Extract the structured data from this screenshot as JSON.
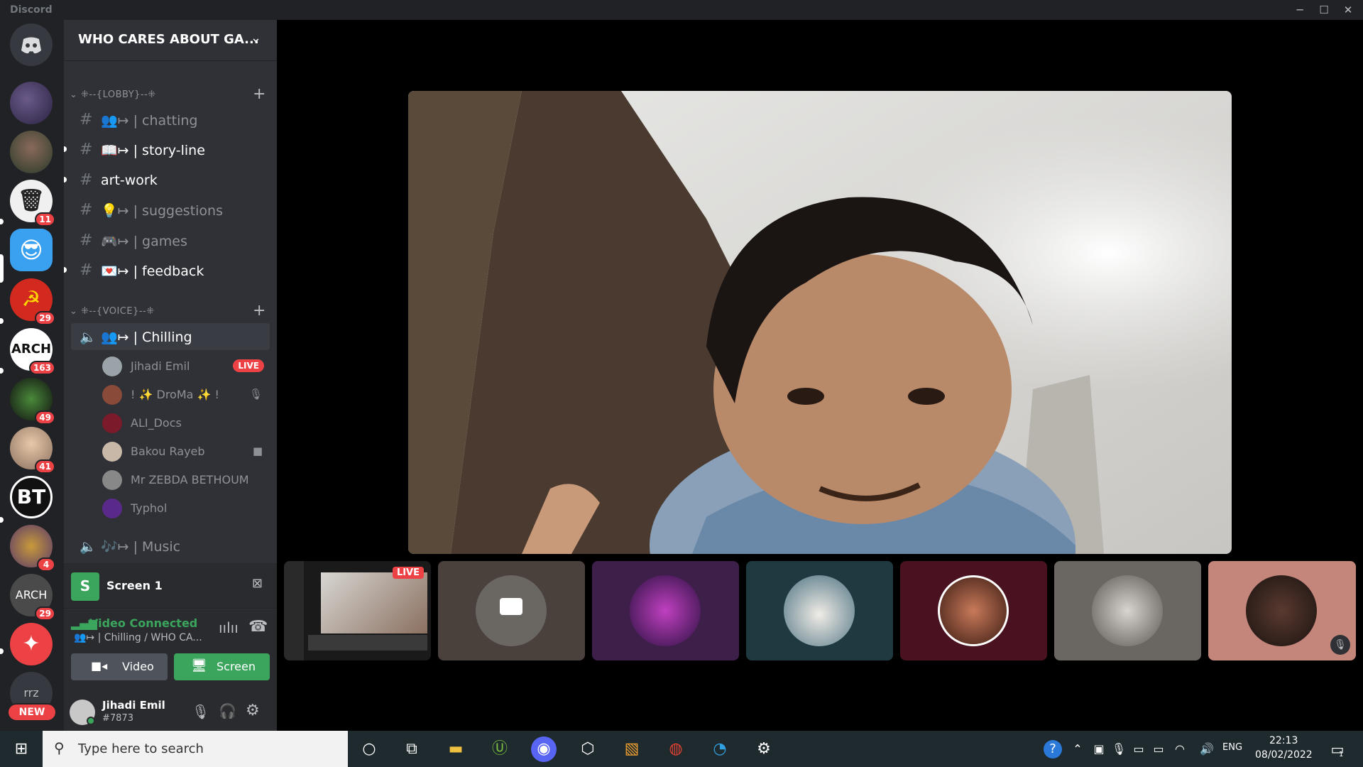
{
  "app": {
    "title": "Discord"
  },
  "window_controls": {
    "minimize": "─",
    "maximize": "☐",
    "close": "✕"
  },
  "servers": {
    "badges": [
      "11",
      "29",
      "163",
      "49",
      "41",
      "4",
      "29"
    ],
    "labels": {
      "arch": "ARCH",
      "bt": "BT",
      "arch2": "ARCH",
      "rrz": "rrz"
    },
    "new_label": "NEW"
  },
  "guild": {
    "name": "WHO CARES ABOUT GA..."
  },
  "lobby": {
    "category": "⁜--{LOBBY}--⁜",
    "channels": [
      {
        "label": "👥↦ | chatting"
      },
      {
        "label": "📖↦ | story-line"
      },
      {
        "label": "art-work"
      },
      {
        "label": "💡↦ | suggestions"
      },
      {
        "label": "🎮↦ | games"
      },
      {
        "label": "💌↦ | feedback"
      }
    ]
  },
  "voice": {
    "category": "⁜--{VOICE}--⁜",
    "chilling": "👥↦ | Chilling",
    "music": "🎶↦ | Music",
    "users": [
      {
        "name": "Jihadi Emil",
        "live": "LIVE"
      },
      {
        "name": "! ✨ DroMa ✨ !"
      },
      {
        "name": "ALI_Docs"
      },
      {
        "name": "Bakou Rayeb"
      },
      {
        "name": "Mr ZEBDA BETHOUM"
      },
      {
        "name": "Typhol"
      }
    ]
  },
  "stream": {
    "name": "Screen 1",
    "icon_letter": "S"
  },
  "voice_status": {
    "status": "Video Connected",
    "channel": "👥↦ | Chilling / WHO CA...",
    "video_button": "Video",
    "screen_button": "Screen"
  },
  "user": {
    "name": "Jihadi Emil",
    "tag": "#7873"
  },
  "tiles": {
    "live": "LIVE"
  },
  "taskbar": {
    "search_placeholder": "Type here to search",
    "lang": "ENG",
    "time": "22:13",
    "date": "08/02/2022",
    "notif_count": "1"
  },
  "colors": {
    "accent": "#5865f2",
    "green": "#3ba55d",
    "red": "#ed4245",
    "channel_bg": "#2f3136",
    "server_bg": "#202225"
  }
}
